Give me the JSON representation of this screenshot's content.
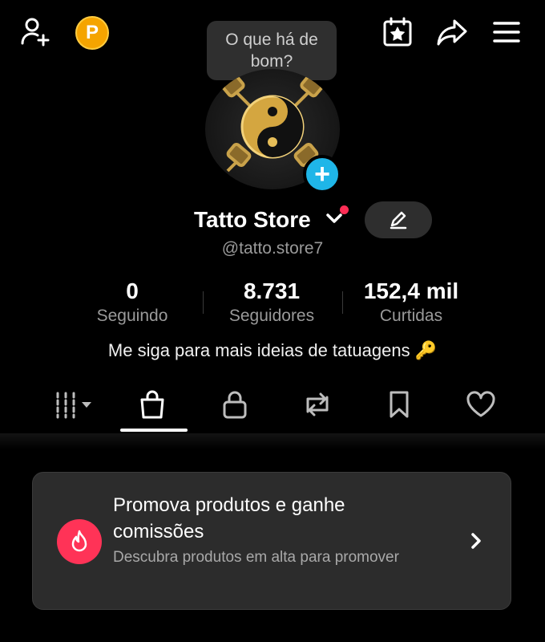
{
  "tooltip": {
    "text": "O que há de bom?"
  },
  "top_bar": {
    "coin_label": "P",
    "icons": [
      "add-user-icon",
      "coin-icon",
      "calendar-star-icon",
      "share-icon",
      "menu-icon"
    ]
  },
  "profile": {
    "name": "Tatto Store",
    "handle": "@tatto.store7",
    "bio": "Me siga para mais ideias de tatuagens 🔑",
    "avatar_add_label": "+"
  },
  "stats": [
    {
      "value": "0",
      "label": "Seguindo"
    },
    {
      "value": "8.731",
      "label": "Seguidores"
    },
    {
      "value": "152,4 mil",
      "label": "Curtidas"
    }
  ],
  "tabs": [
    {
      "icon": "grid-icon",
      "active": false
    },
    {
      "icon": "shopping-bag-icon",
      "active": true
    },
    {
      "icon": "lock-icon",
      "active": false
    },
    {
      "icon": "repost-icon",
      "active": false
    },
    {
      "icon": "bookmark-icon",
      "active": false
    },
    {
      "icon": "heart-icon",
      "active": false
    }
  ],
  "promo": {
    "title": "Promova produtos e ganhe comissões",
    "description": "Descubra produtos em alta para promover"
  },
  "colors": {
    "background": "#000000",
    "accent_blue": "#1fb6e8",
    "promo_icon": "#ff3357",
    "coin": "#f5a400",
    "notification": "#ff2d55"
  }
}
